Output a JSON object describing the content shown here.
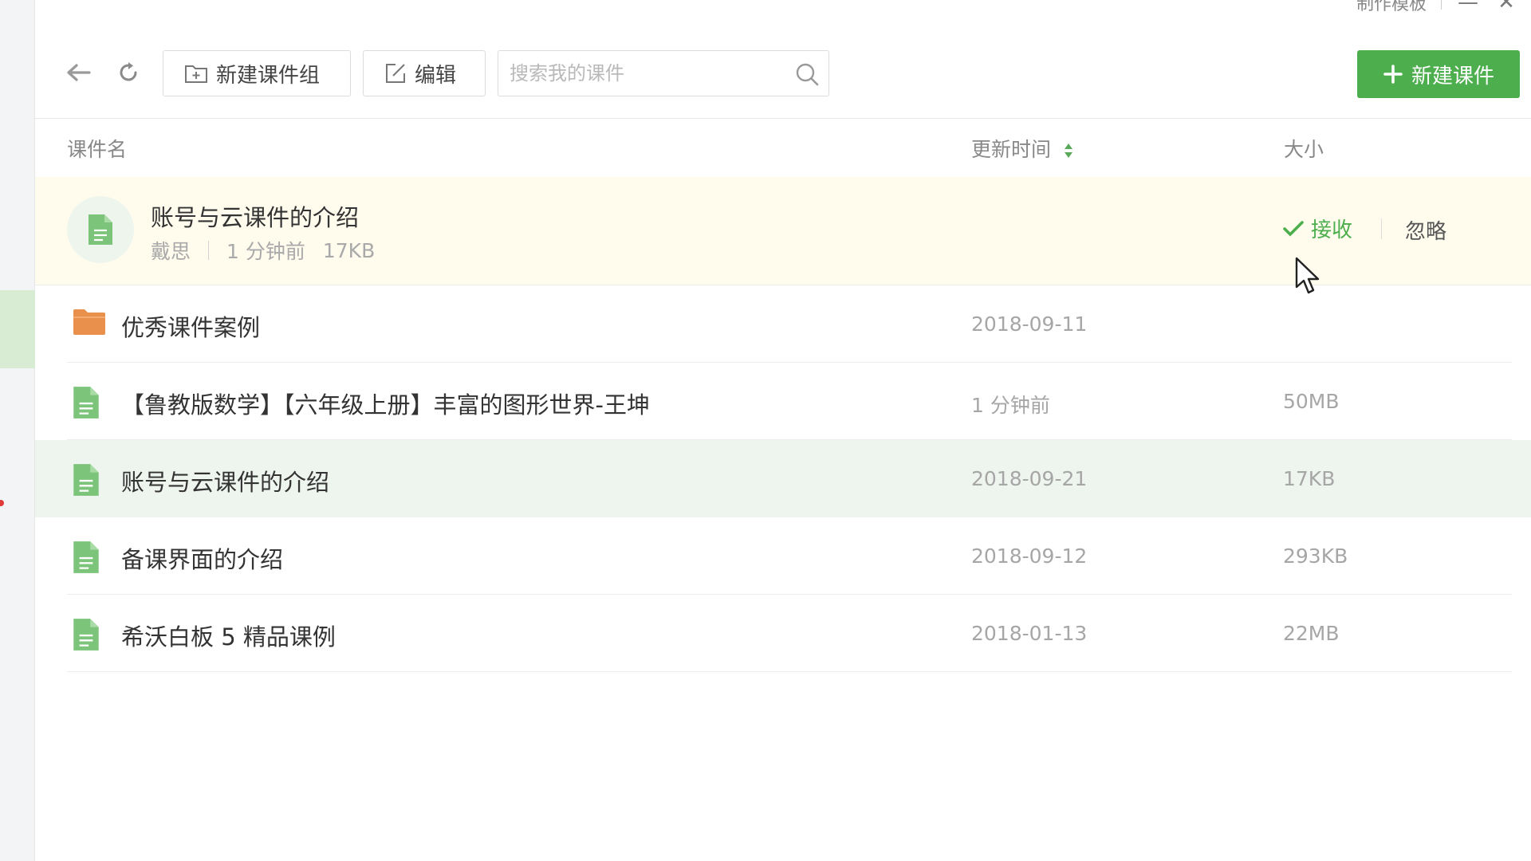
{
  "window": {
    "top_label": "制作模板",
    "minimize_icon": "minimize-icon",
    "close_icon": "close-icon"
  },
  "toolbar": {
    "back_icon": "back-arrow-icon",
    "refresh_icon": "refresh-icon",
    "new_group_label": "新建课件组",
    "edit_label": "编辑",
    "search_placeholder": "搜索我的课件",
    "search_value": "",
    "new_courseware_label": "新建课件"
  },
  "columns": {
    "name": "课件名",
    "updated": "更新时间",
    "size": "大小"
  },
  "pending": {
    "title": "账号与云课件的介绍",
    "sender": "戴思",
    "time": "1 分钟前",
    "size": "17KB",
    "accept_label": "接收",
    "ignore_label": "忽略"
  },
  "items": [
    {
      "type": "folder",
      "name": "优秀课件案例",
      "time": "2018-09-11",
      "size": ""
    },
    {
      "type": "file",
      "name": "【鲁教版数学】【六年级上册】丰富的图形世界-王坤",
      "time": "1 分钟前",
      "size": "50MB"
    },
    {
      "type": "file",
      "name": "账号与云课件的介绍",
      "time": "2018-09-21",
      "size": "17KB"
    },
    {
      "type": "file",
      "name": "备课界面的介绍",
      "time": "2018-09-12",
      "size": "293KB"
    },
    {
      "type": "file",
      "name": "希沃白板 5 精品课例",
      "time": "2018-01-13",
      "size": "22MB"
    }
  ],
  "colors": {
    "accent_green": "#4cae4c",
    "folder_orange": "#e8904c",
    "file_green": "#7cc47a",
    "pending_bg": "#fffcee",
    "selected_bg": "#eef4ee"
  }
}
